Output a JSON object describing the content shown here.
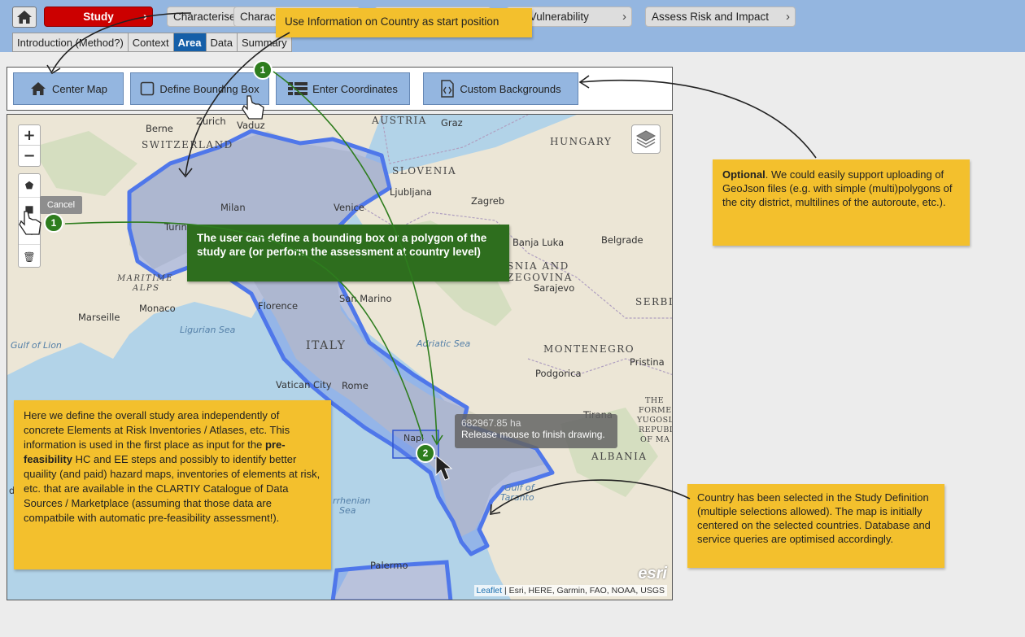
{
  "topbar": {
    "steps": [
      "Study",
      "Characterise",
      "Charact",
      "Analyse Vulnerability",
      "Assess Risk and Impact"
    ],
    "tabs": [
      "Introduction (Method?)",
      "Context",
      "Area",
      "Data",
      "Summary"
    ],
    "active_tab": "Area"
  },
  "toolbar": {
    "center_map": "Center Map",
    "bounding_box": "Define Bounding Box",
    "enter_coordinates": "Enter Coordinates",
    "custom_backgrounds": "Custom Backgrounds"
  },
  "map": {
    "zoom_in": "+",
    "zoom_out": "−",
    "cancel": "Cancel",
    "tooltip_area": "682967.85 ha",
    "tooltip_hint": "Release mouse to finish drawing.",
    "attribution_leaflet": "Leaflet",
    "attribution_rest": " | Esri, HERE, Garmin, FAO, NOAA, USGS",
    "esri": "esri",
    "labels": {
      "berne": "Berne",
      "zurich": "Zurich",
      "vaduz": "Vaduz",
      "switzerland": "SWITZERLAND",
      "austria": "AUSTRIA",
      "graz": "Graz",
      "hungary": "HUNGARY",
      "slovenia": "SLOVENIA",
      "ljubljana": "Ljubljana",
      "zagreb": "Zagreb",
      "milan": "Milan",
      "venice": "Venice",
      "turin": "Turin",
      "banja_luka": "Banja Luka",
      "belgrade": "Belgrade",
      "bosnia": "SNIA AND",
      "herzegovina": "ZEGOVINA",
      "sarajevo": "Sarajevo",
      "serbia": "SERBI",
      "maritime_alps": "MARITIME",
      "alps": "ALPS",
      "monaco": "Monaco",
      "marseille": "Marseille",
      "florence": "Florence",
      "san_marino": "San Marino",
      "ligurian_sea": "Ligurian Sea",
      "gulf_of_lion": "Gulf of Lion",
      "italy": "ITALY",
      "adriatic_sea": "Adriatic Sea",
      "montenegro": "MONTENEGRO",
      "pristina": "Pristina",
      "podgorica": "Podgorica",
      "vatican_city": "Vatican City",
      "rome": "Rome",
      "tirana": "Tirana",
      "albania": "ALBANIA",
      "the_former": "THE",
      "yugoslav": "FORMER",
      "republic": "YUGOSLAV",
      "macedonia": "REPUBLIC",
      "of_ma": "OF MA",
      "naples": "Napl",
      "gulf_of_taranto": "Gulf of",
      "taranto": "Taranto",
      "tyrrhenian": "rrhenian",
      "sea": "Sea",
      "palermo": "Palermo",
      "de": "de"
    }
  },
  "notes": {
    "start_position": "Use Information on Country as start position",
    "optional_bold": "Optional",
    "optional_rest": ". We could easily support uploading of GeoJson files (e.g. with simple (multi)polygons of the city district, multilines of the autoroute, etc.).",
    "bounding_box": "The user can define a bounding box or a polygon of the study are (or perform the assessment at country level)",
    "study_area_part1": "Here we define the overall study area independently of concrete Elements at Risk Inventories / Atlases, etc. This information is used in the first place as input for the ",
    "study_area_bold": "pre-feasibility",
    "study_area_part2": " HC and EE steps and possibly to identify better quaility (and paid) hazard maps, inventories of elements at risk, etc. that are available in the CLARTIY Catalogue of Data Sources / Marketplace (assuming that those data are compatbile with automatic pre-feasibility assessment!).",
    "country_selected": "Country has been selected in the Study Definition (multiple selections allowed). The map is initially centered on the selected countries. Database and service queries are optimised accordingly."
  },
  "badges": {
    "one": "1",
    "two": "2"
  },
  "colors": {
    "topbar": "#94b6e0",
    "study_step": "#cc0000",
    "active_tab": "#155fa8",
    "note_yellow": "#f3c02d",
    "note_green": "#2e6e1e",
    "polygon": "#5b7de8"
  }
}
